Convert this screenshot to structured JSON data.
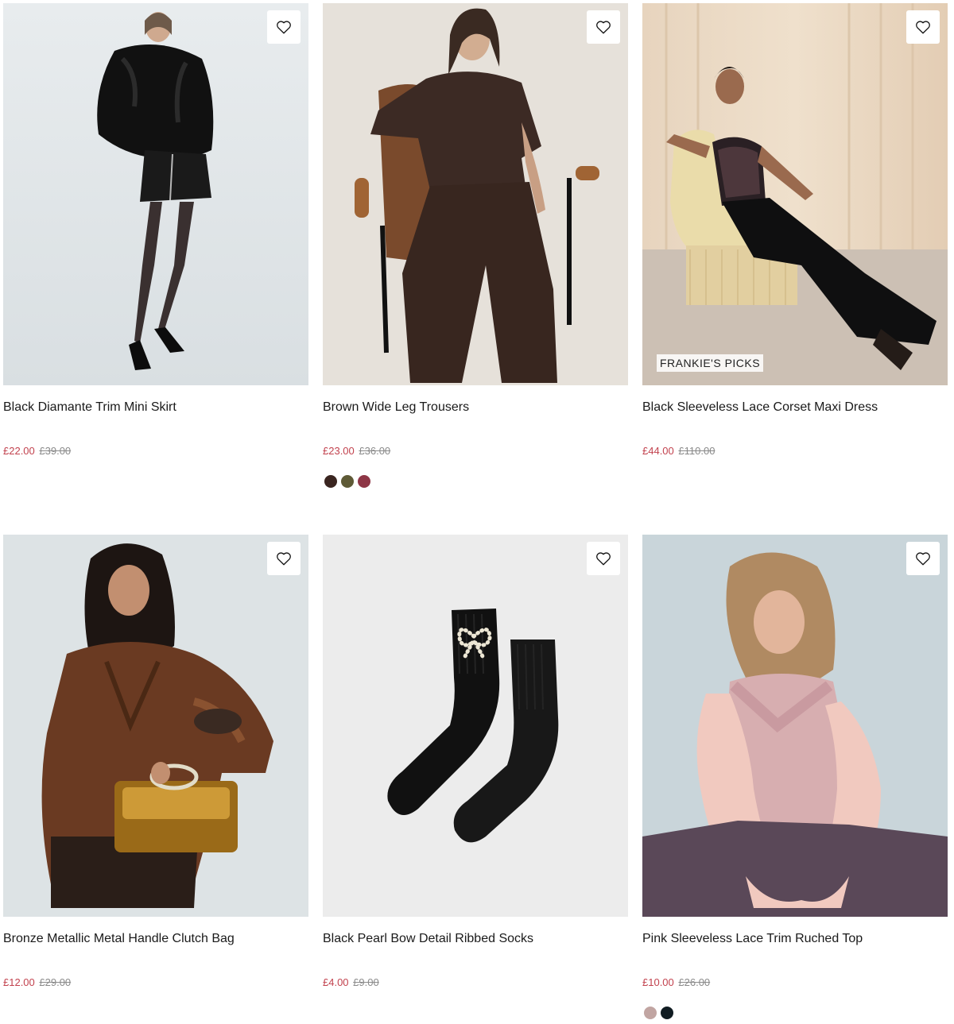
{
  "products": [
    {
      "title": "Black Diamante Trim Mini Skirt",
      "sale_price": "£22.00",
      "original_price": "£39.00",
      "image": "woman-fur-jacket-mini-skirt-photo",
      "wishlist_icon": "heart-icon"
    },
    {
      "title": "Brown Wide Leg Trousers",
      "sale_price": "£23.00",
      "original_price": "£36.00",
      "image": "woman-brown-set-chair-photo",
      "wishlist_icon": "heart-icon",
      "swatches": [
        "#3a2520",
        "#5e5a36",
        "#8e3646"
      ]
    },
    {
      "title": "Black Sleeveless Lace Corset Maxi Dress",
      "sale_price": "£44.00",
      "original_price": "£110.00",
      "image": "woman-corset-dress-sofa-photo",
      "wishlist_icon": "heart-icon",
      "badge": "FRANKIE'S PICKS"
    },
    {
      "title": "Bronze Metallic Metal Handle Clutch Bag",
      "sale_price": "£12.00",
      "original_price": "£29.00",
      "image": "woman-satin-blouse-gold-bag-photo",
      "wishlist_icon": "heart-icon"
    },
    {
      "title": "Black Pearl Bow Detail Ribbed Socks",
      "sale_price": "£4.00",
      "original_price": "£9.00",
      "image": "black-socks-pearl-bow-photo",
      "wishlist_icon": "heart-icon"
    },
    {
      "title": "Pink Sleeveless Lace Trim Ruched Top",
      "sale_price": "£10.00",
      "original_price": "£26.00",
      "image": "woman-pink-lace-top-photo",
      "wishlist_icon": "heart-icon",
      "swatches": [
        "#c1a5a2",
        "#111c22"
      ]
    }
  ],
  "colors": {
    "sale": "#c2424e",
    "original": "#8a8a8a",
    "text": "#1a1a1a"
  }
}
